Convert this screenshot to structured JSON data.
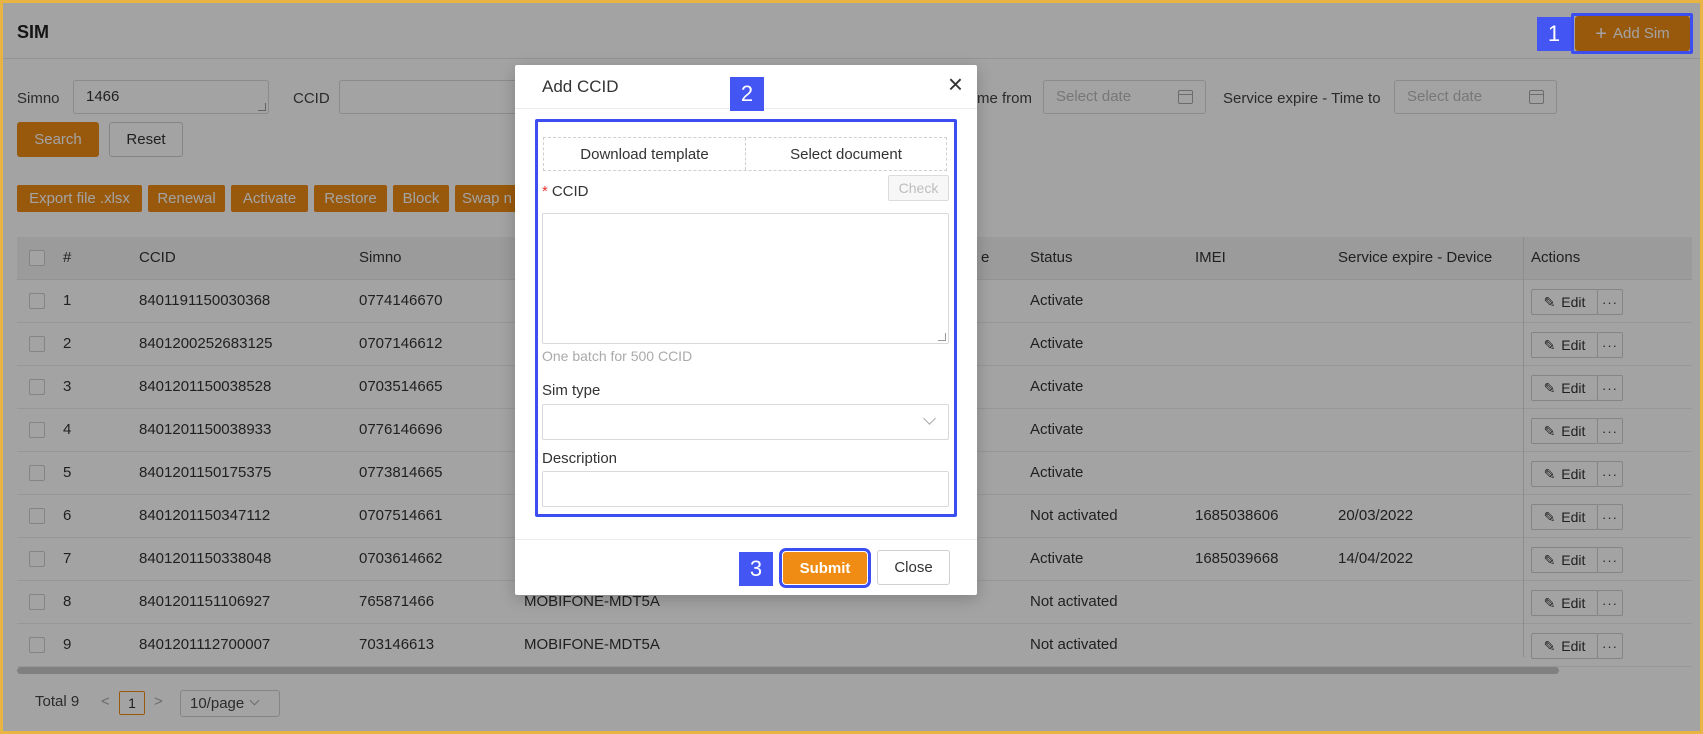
{
  "page": {
    "title": "SIM",
    "add_sim_label": "Add Sim"
  },
  "filters": {
    "simno_label": "Simno",
    "simno_value": "1466",
    "ccid_label": "CCID",
    "svc_from_label": "me from",
    "svc_to_label": "Service expire - Time to",
    "date_placeholder": "Select date",
    "search_label": "Search",
    "reset_label": "Reset"
  },
  "toolbar": [
    "Export file .xlsx",
    "Renewal",
    "Activate",
    "Restore",
    "Block",
    "Swap n"
  ],
  "table": {
    "headers": {
      "num": "#",
      "ccid": "CCID",
      "simno": "Simno",
      "hidden": "e",
      "status": "Status",
      "imei": "IMEI",
      "svc": "Service expire - Device",
      "actions": "Actions"
    },
    "rows": [
      {
        "num": "1",
        "ccid": "8401191150030368",
        "simno": "0774146670",
        "type": "",
        "status": "Activate",
        "imei": "",
        "svc": ""
      },
      {
        "num": "2",
        "ccid": "8401200252683125",
        "simno": "0707146612",
        "type": "",
        "status": "Activate",
        "imei": "",
        "svc": ""
      },
      {
        "num": "3",
        "ccid": "8401201150038528",
        "simno": "0703514665",
        "type": "",
        "status": "Activate",
        "imei": "",
        "svc": ""
      },
      {
        "num": "4",
        "ccid": "8401201150038933",
        "simno": "0776146696",
        "type": "",
        "status": "Activate",
        "imei": "",
        "svc": ""
      },
      {
        "num": "5",
        "ccid": "8401201150175375",
        "simno": "0773814665",
        "type": "",
        "status": "Activate",
        "imei": "",
        "svc": ""
      },
      {
        "num": "6",
        "ccid": "8401201150347112",
        "simno": "0707514661",
        "type": "",
        "status": "Not activated",
        "imei": "1685038606",
        "svc": "20/03/2022"
      },
      {
        "num": "7",
        "ccid": "8401201150338048",
        "simno": "0703614662",
        "type": "",
        "status": "Activate",
        "imei": "1685039668",
        "svc": "14/04/2022"
      },
      {
        "num": "8",
        "ccid": "8401201151106927",
        "simno": "765871466",
        "type": "MOBIFONE-MDT5A",
        "status": "Not activated",
        "imei": "",
        "svc": ""
      },
      {
        "num": "9",
        "ccid": "8401201112700007",
        "simno": "703146613",
        "type": "MOBIFONE-MDT5A",
        "status": "Not activated",
        "imei": "",
        "svc": ""
      }
    ],
    "edit_label": "Edit",
    "more_label": "···"
  },
  "pagination": {
    "total": "Total 9",
    "prev": "<",
    "page": "1",
    "next": ">",
    "size": "10/page"
  },
  "modal": {
    "title": "Add CCID",
    "close": "×",
    "download_template": "Download template",
    "select_document": "Select document",
    "ccid_label": "CCID",
    "required_mark": "*",
    "check_label": "Check",
    "help": "One batch for 500 CCID",
    "sim_type_label": "Sim type",
    "description_label": "Description",
    "submit_label": "Submit",
    "close_label": "Close"
  },
  "annotations": {
    "b1": "1",
    "b2": "2",
    "b3": "3"
  },
  "colors": {
    "accent": "#f08c14",
    "highlight": "#3c4ef0",
    "frame": "#e8b544"
  }
}
